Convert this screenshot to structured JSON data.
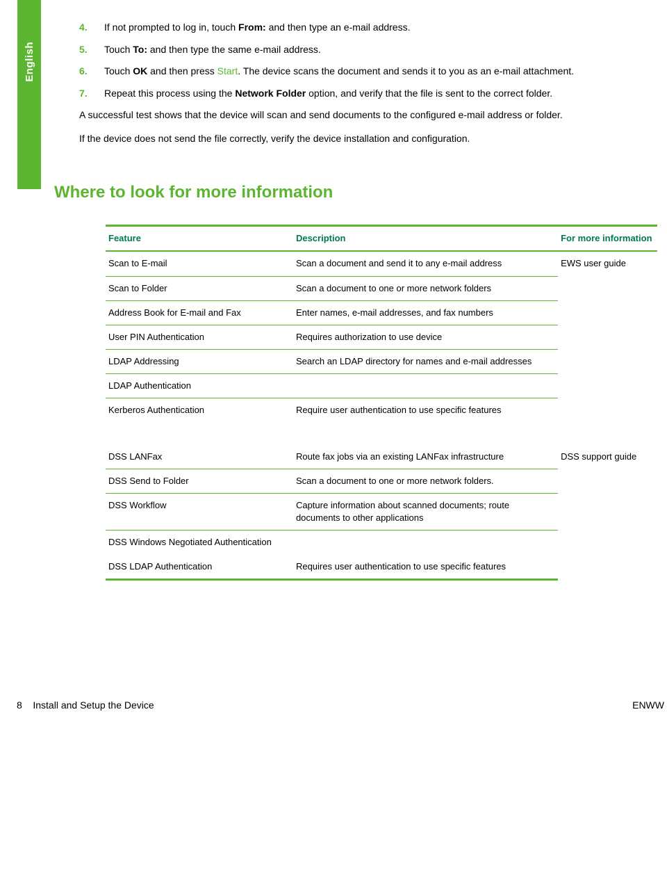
{
  "side_tab": "English",
  "steps": [
    {
      "pre": "If not prompted to log in, touch ",
      "b1": "From:",
      "mid": " and then type an e-mail address."
    },
    {
      "pre": "Touch ",
      "b1": "To:",
      "mid": " and then type the same e-mail address."
    },
    {
      "pre": "Touch ",
      "b1": "OK",
      "mid": " and then press ",
      "g1": "Start",
      "post": ". The device scans the document and sends it to you as an e-mail attachment."
    },
    {
      "pre": "Repeat this process using the ",
      "b1": "Network Folder",
      "mid": " option, and verify that the file is sent to the correct folder."
    }
  ],
  "paras": [
    "A successful test shows that the device will scan and send documents to the configured e-mail address or folder.",
    "If the device does not send the file correctly, verify the device installation and configuration."
  ],
  "section_heading": "Where to look for more information",
  "table": {
    "headers": [
      "Feature",
      "Description",
      "For more information"
    ],
    "group1": {
      "rows": [
        {
          "f": "Scan to E-mail",
          "d": "Scan a document and send it to any e-mail address"
        },
        {
          "f": "Scan to Folder",
          "d": "Scan a document to one or more network folders"
        },
        {
          "f": "Address Book for E-mail and Fax",
          "d": "Enter names, e-mail addresses, and fax numbers"
        },
        {
          "f": "User PIN Authentication",
          "d": "Requires authorization to use device"
        },
        {
          "f": "LDAP Addressing",
          "d": "Search an LDAP directory for names and e-mail addresses"
        },
        {
          "f": "LDAP Authentication",
          "d": ""
        },
        {
          "f": "Kerberos Authentication",
          "d": "Require user authentication to use specific features"
        }
      ],
      "ref": "EWS user guide"
    },
    "group2": {
      "rows": [
        {
          "f": "DSS LANFax",
          "d": "Route fax jobs via an existing LANFax infrastructure"
        },
        {
          "f": "DSS Send to Folder",
          "d": "Scan a document to one or more network folders."
        },
        {
          "f": "DSS Workflow",
          "d": "Capture information about scanned documents; route documents to other applications"
        },
        {
          "f": "DSS Windows Negotiated Authentication",
          "d": ""
        },
        {
          "f": "DSS LDAP Authentication",
          "d": "Requires user authentication to use specific features"
        }
      ],
      "ref": "DSS support guide"
    }
  },
  "footer": {
    "page_num": "8",
    "title": "Install and Setup the Device",
    "right": "ENWW"
  }
}
